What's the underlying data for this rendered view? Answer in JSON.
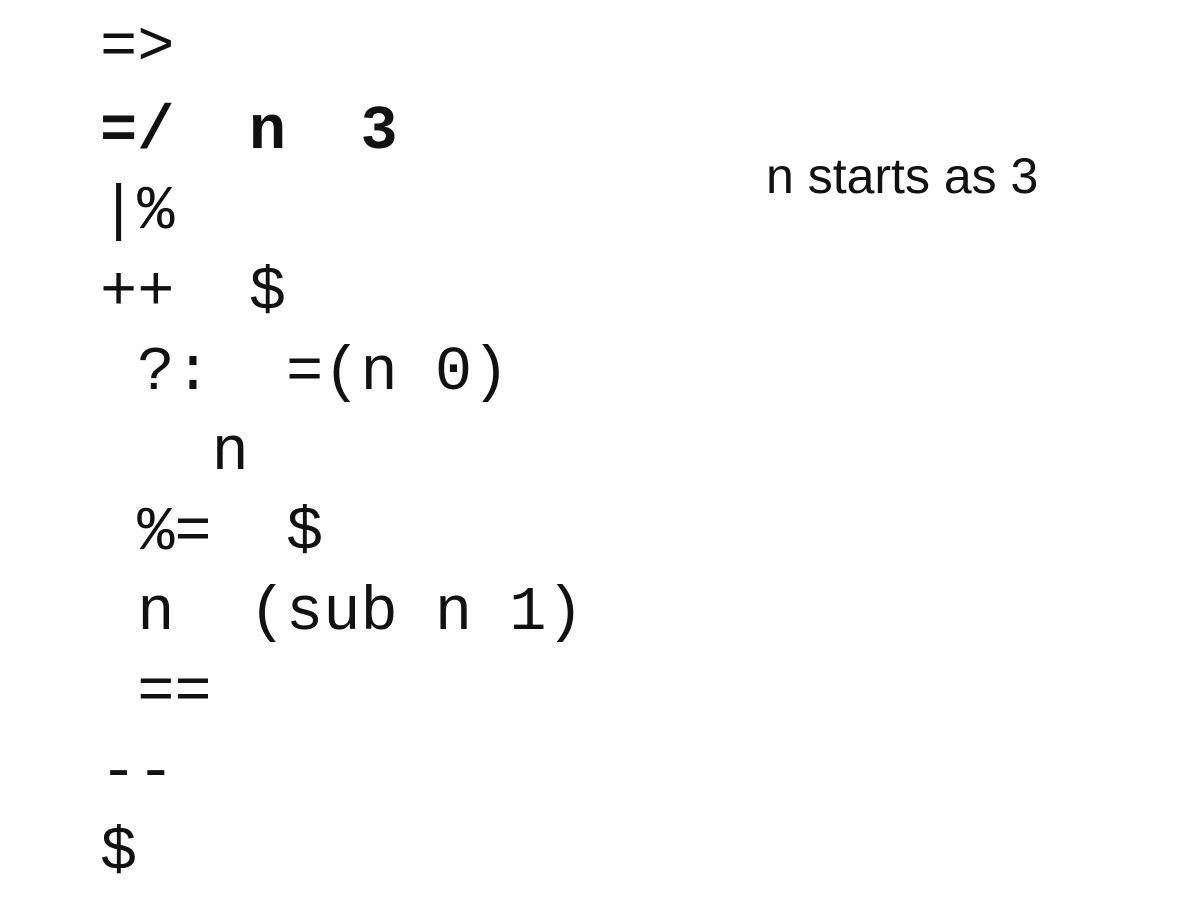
{
  "code": {
    "lines": [
      {
        "text": "=>",
        "bold": false
      },
      {
        "text": "=/  n  3",
        "bold": true
      },
      {
        "text": "|%",
        "bold": false
      },
      {
        "text": "++  $",
        "bold": false
      },
      {
        "text": " ?:  =(n 0)",
        "bold": false
      },
      {
        "text": "   n",
        "bold": false
      },
      {
        "text": " %=  $",
        "bold": false
      },
      {
        "text": " n  (sub n 1)",
        "bold": false
      },
      {
        "text": " ==",
        "bold": false
      },
      {
        "text": "--",
        "bold": false
      },
      {
        "text": "$",
        "bold": false
      }
    ]
  },
  "annotation": {
    "text": "n starts as 3"
  }
}
